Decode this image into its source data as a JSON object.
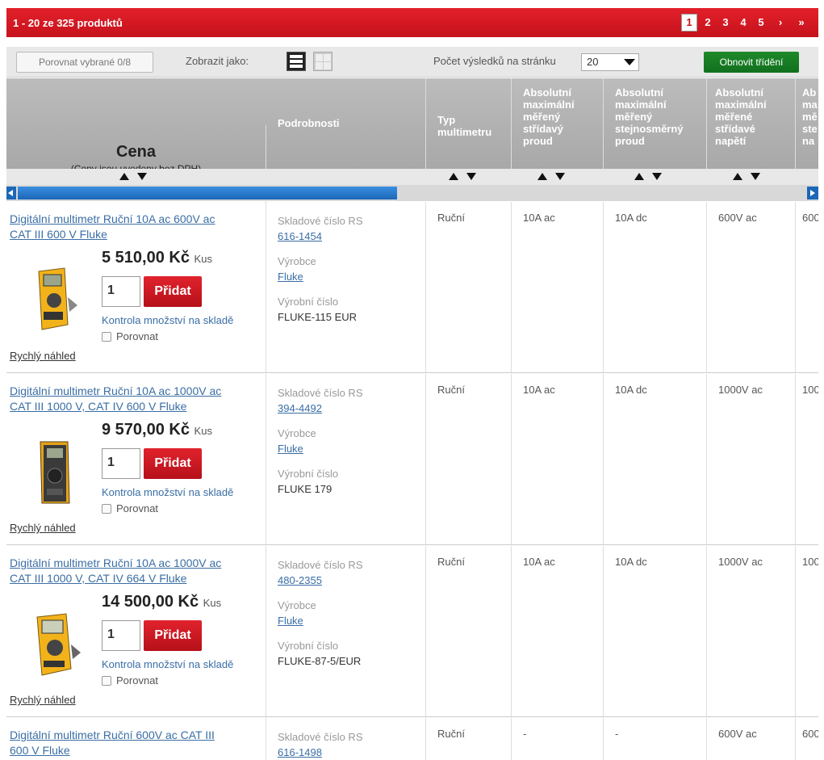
{
  "header": {
    "count": "1 - 20 ze 325 produktů",
    "pages": [
      "1",
      "2",
      "3",
      "4",
      "5"
    ],
    "current_page": "1",
    "next": "›",
    "last": "»"
  },
  "toolbar": {
    "compare": "Porovnat vybrané 0/8",
    "view_label": "Zobrazit jako:",
    "perpage_label": "Počet výsledků na stránku",
    "perpage_value": "20",
    "refresh": "Obnovit třídění"
  },
  "columns": {
    "price": "Cena",
    "price_sub": "(Ceny jsou uvedeny bez DPH)",
    "details": "Podrobnosti",
    "c3": [
      "Typ",
      "multimetru"
    ],
    "c4": [
      "Absolutní",
      "maximální",
      "měřený",
      "střídavý",
      "proud"
    ],
    "c5": [
      "Absolutní",
      "maximální",
      "měřený",
      "stejnosměrný",
      "proud"
    ],
    "c6": [
      "Absolutní",
      "maximální",
      "měřené",
      "střídavé",
      "napětí"
    ],
    "c7": [
      "Ab",
      "ma",
      "mě",
      "ste",
      "na"
    ]
  },
  "labels": {
    "stock_no": "Skladové číslo RS",
    "maker": "Výrobce",
    "maker_no": "Výrobní číslo",
    "add": "Přidat",
    "stock_check": "Kontrola množství na skladě",
    "compare": "Porovnat",
    "quick": "Rychlý náhled",
    "unit": "Kus"
  },
  "products": [
    {
      "title_1": "Digitální multimetr Ruční 10A ac 600V ac",
      "title_2": "CAT III 600 V Fluke",
      "price": "5 510,00 Kč",
      "qty": "1",
      "stock_no": "616-1454",
      "maker": "Fluke",
      "maker_no": "FLUKE-115 EUR",
      "type": "Ruční",
      "ac_current": "10A ac",
      "dc_current": "10A dc",
      "ac_voltage": "600V ac",
      "c7": "600"
    },
    {
      "title_1": "Digitální multimetr Ruční 10A ac 1000V ac",
      "title_2": "CAT III 1000 V, CAT IV 600 V Fluke",
      "price": "9 570,00 Kč",
      "qty": "1",
      "stock_no": "394-4492",
      "maker": "Fluke",
      "maker_no": "FLUKE 179",
      "type": "Ruční",
      "ac_current": "10A ac",
      "dc_current": "10A dc",
      "ac_voltage": "1000V ac",
      "c7": "100"
    },
    {
      "title_1": "Digitální multimetr Ruční 10A ac 1000V ac",
      "title_2": "CAT III 1000 V, CAT IV 664 V Fluke",
      "price": "14 500,00 Kč",
      "qty": "1",
      "stock_no": "480-2355",
      "maker": "Fluke",
      "maker_no": "FLUKE-87-5/EUR",
      "type": "Ruční",
      "ac_current": "10A ac",
      "dc_current": "10A dc",
      "ac_voltage": "1000V ac",
      "c7": "100"
    },
    {
      "title_1": "Digitální multimetr Ruční 600V ac CAT III",
      "title_2": "600 V Fluke",
      "stock_no": "616-1498",
      "type": "Ruční",
      "ac_current": "-",
      "dc_current": "-",
      "ac_voltage": "600V ac",
      "c7": "600"
    }
  ]
}
